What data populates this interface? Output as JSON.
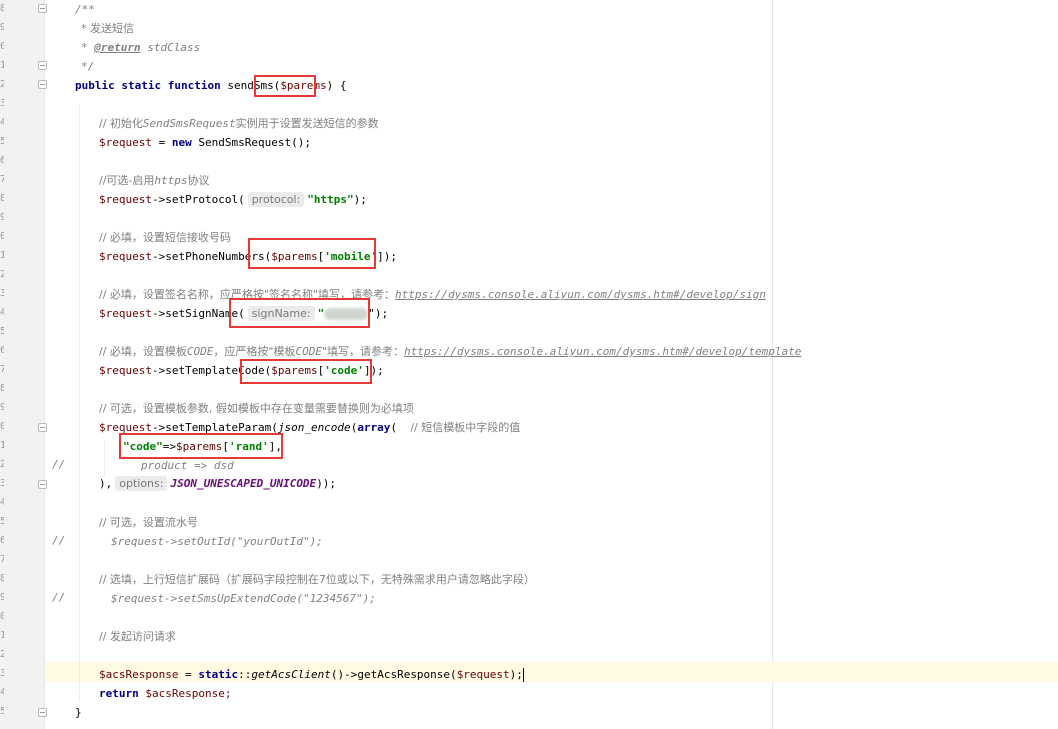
{
  "editor": {
    "line_numbers": [
      "8",
      "9",
      "0",
      "1",
      "2",
      "3",
      "4",
      "5",
      "6",
      "7",
      "8",
      "9",
      "0",
      "1",
      "2",
      "3",
      "4",
      "5",
      "6",
      "7",
      "8",
      "9",
      "0",
      "1",
      "2",
      "3",
      "4",
      "5",
      "6",
      "7",
      "8",
      "9",
      "0",
      "1",
      "2",
      "3",
      "4",
      "5"
    ],
    "comment_marker": "//",
    "doc_open": "/**",
    "doc_desc": "* 发送短信",
    "doc_star": "* ",
    "doc_return_tag": "@return",
    "doc_return_type": " stdClass",
    "doc_close": "*/",
    "sig_kw": "public static function ",
    "sig_name": "sendSms(",
    "sig_param": "$parems",
    "sig_end": ") {",
    "c_init_prefix": "// 初始化",
    "c_init_class": "SendSmsRequest",
    "c_init_suffix": "实例用于设置发送短信的参数",
    "l_new_var": "$request",
    "l_new_eq": " = ",
    "l_new_kw": "new",
    "l_new_rest": " SendSmsRequest();",
    "c_proto_prefix": "//可选-启用",
    "c_proto_word": "https",
    "c_proto_suffix": "协议",
    "l_proto_call": "->setProtocol(",
    "l_proto_hint": "protocol:",
    "l_proto_str": "\"https\"",
    "l_proto_end": ");",
    "c_phone": "// 必填，设置短信接收号码",
    "l_phone_call": "->setPhoneNumbers(",
    "l_phone_var": "$parems",
    "l_phone_str": "'mobile'",
    "l_phone_end": "]);",
    "c_sign_prefix": "// 必填，设置签名名称，应严格按\"签名名称\"填写，请参考：",
    "c_sign_link": "https://dysms.console.aliyun.com/dysms.htm#/develop/sign",
    "l_sign_call": "->setSignName(",
    "l_sign_hint": "signName:",
    "l_sign_quote": "\"",
    "l_sign_end": "\");",
    "c_tpl_prefix": "// 必填，设置模板",
    "c_tpl_code": "CODE",
    "c_tpl_mid": "，应严格按\"模板",
    "c_tpl_mid2": "CODE",
    "c_tpl_mid3": "\"填写，请参考：",
    "c_tpl_link": "https://dysms.console.aliyun.com/dysms.htm#/develop/template",
    "l_tpl_call": "->setTemplateCode(",
    "l_tpl_var": "$parems",
    "l_tpl_str": "'code'",
    "l_tpl_end": "]);",
    "c_param": "// 可选，设置模板参数, 假如模板中存在变量需要替换则为必填项",
    "l_param_call": "->setTemplateParam(",
    "l_param_fn": "json_encode",
    "l_param_open": "(",
    "l_param_arr": "array",
    "l_param_open2": "(  ",
    "l_param_cmt": "// 短信模板中字段的值",
    "l_code_key": "\"code\"",
    "l_code_arrow": "=>",
    "l_code_var": "$parems",
    "l_code_str": "'rand'",
    "l_code_end": "],",
    "l_product": "product => dsd",
    "l_close_paren": "),",
    "l_options_hint": "options:",
    "l_options_const": "JSON_UNESCAPED_UNICODE",
    "l_options_end": "));",
    "c_outid": "// 可选，设置流水号",
    "l_outid": "$request->setOutId(\"yourOutId\");",
    "c_ext": "// 选填，上行短信扩展码（扩展码字段控制在7位或以下，无特殊需求用户请忽略此字段）",
    "l_ext": "$request->setSmsUpExtendCode(\"1234567\");",
    "c_send": "// 发起访问请求",
    "l_acs_var": "$acsResponse",
    "l_acs_eq": " = ",
    "l_acs_kw": "static",
    "l_acs_sep": "::",
    "l_acs_fn": "getAcsClient",
    "l_acs_rest": "()->getAcsResponse(",
    "l_acs_arg": "$request",
    "l_acs_end": ");",
    "l_return_kw": "return",
    "l_return_var": " $acsResponse;",
    "l_brace": "}"
  }
}
